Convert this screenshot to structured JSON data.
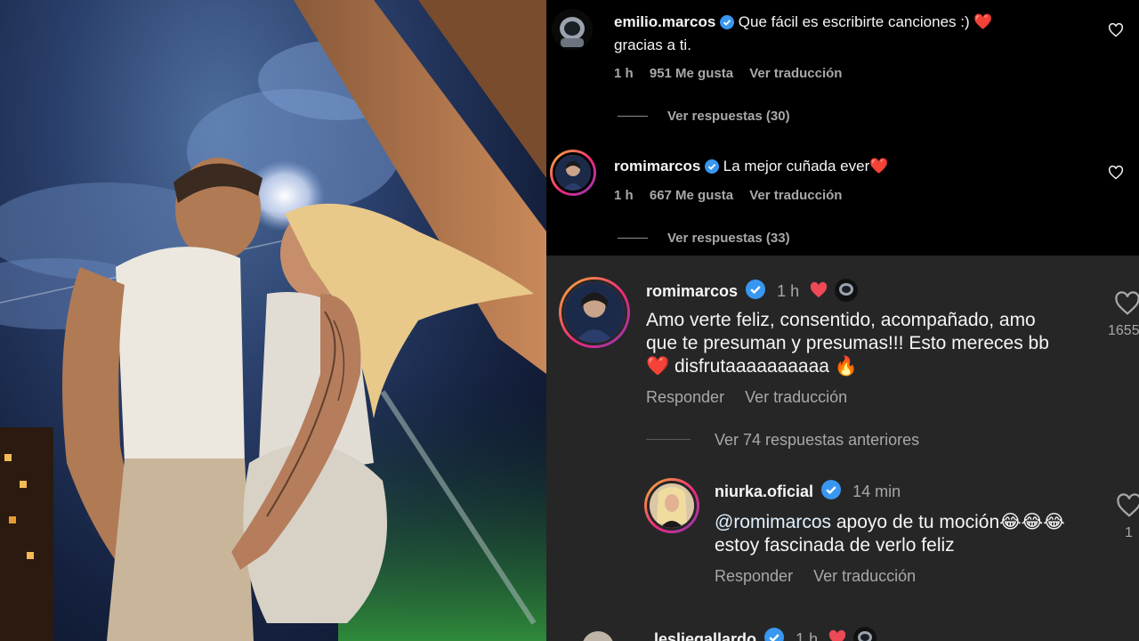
{
  "top_comments": [
    {
      "username": "emilio.marcos",
      "text_line1": "Que fácil es escribirte canciones :) ❤️",
      "text_line2": "gracias a ti.",
      "time": "1 h",
      "likes": "951 Me gusta",
      "translate": "Ver traducción",
      "replies": "Ver respuestas (30)"
    },
    {
      "username": "romimarcos",
      "text_line1": "La mejor cuñada ever❤️",
      "time": "1 h",
      "likes": "667 Me gusta",
      "translate": "Ver traducción",
      "replies": "Ver respuestas (33)"
    }
  ],
  "main_comment": {
    "username": "romimarcos",
    "time": "1 h",
    "text_line1": "Amo verte feliz, consentido, acompañado, amo",
    "text_line2": "que te presuman y presumas!!! Esto mereces bb",
    "text_line3": "❤️ disfrutaaaaaaaaaa 🔥",
    "reply": "Responder",
    "translate": "Ver traducción",
    "like_count": "1655",
    "previous_replies": "Ver 74 respuestas anteriores"
  },
  "reply_comment": {
    "username": "niurka.oficial",
    "time": "14 min",
    "mention": "@romimarcos",
    "text_line1_rest": " apoyo de tu moción😂😂😂",
    "text_line2": "estoy fascinada de verlo feliz",
    "reply": "Responder",
    "translate": "Ver traducción",
    "like_count": "1"
  },
  "next_comment": {
    "username": "lesliegallardo",
    "time": "1 h"
  },
  "colors": {
    "verified_blue": "#3897f0",
    "heart_red": "#ed4956",
    "dark_panel": "#262626",
    "mention_blue": "#e0f1ff"
  }
}
